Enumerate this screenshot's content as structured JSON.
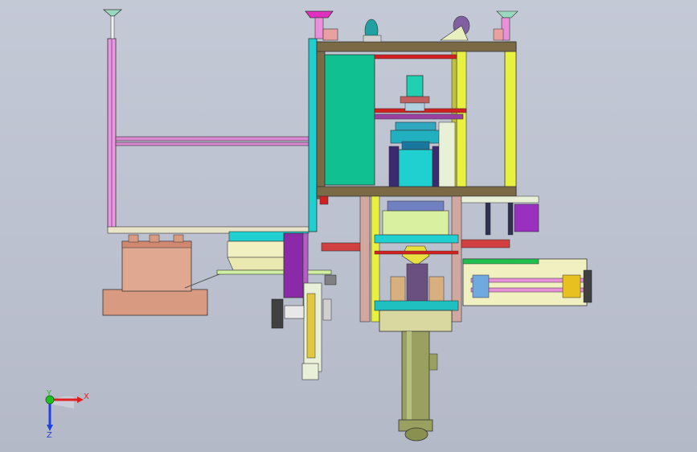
{
  "viewport": {
    "background": "#c0c5d2"
  },
  "triad": {
    "x_label": "X",
    "y_label": "Y",
    "z_label": "Z",
    "x_color": "#e02020",
    "y_color": "#20c020",
    "z_color": "#2040e0"
  },
  "palette": {
    "frame_brown": "#7a6a45",
    "pink_rail": "#e89ae0",
    "teal_panel": "#10c090",
    "cyan_motor": "#20d0d0",
    "yellow_post": "#e8f040",
    "purple_block": "#8a2aa8",
    "copper": "#d89a80",
    "olive_cylinder": "#9aa060",
    "red_bar": "#d02020",
    "lime_plate": "#d8f0a0",
    "khaki_base": "#d8d8a0"
  }
}
